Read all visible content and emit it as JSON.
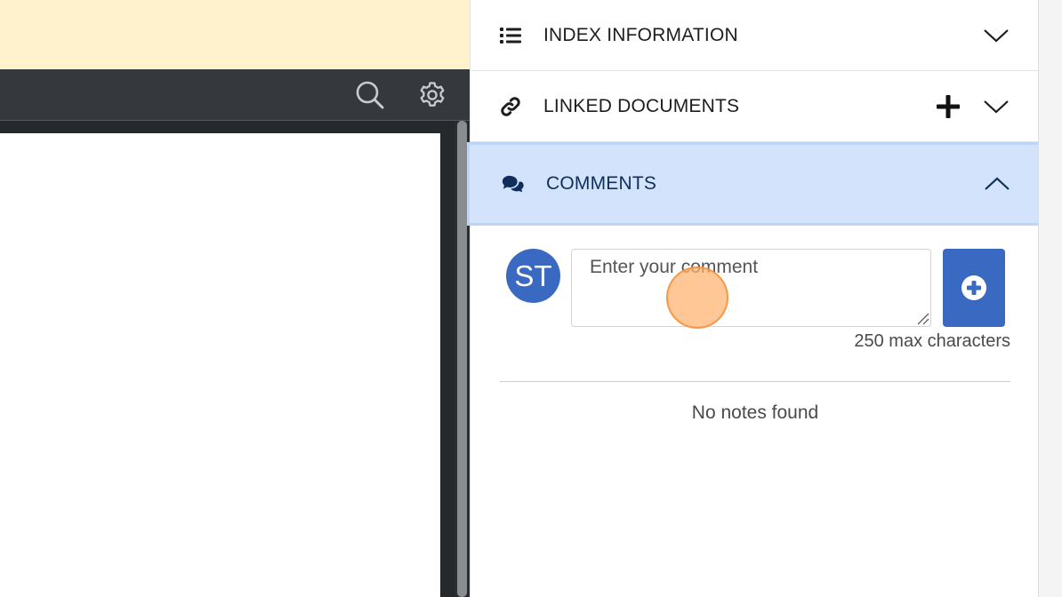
{
  "viewer": {
    "toolbar": {
      "search_icon": "search-icon",
      "settings_icon": "gear-icon"
    }
  },
  "panel": {
    "sections": {
      "index": {
        "title": "INDEX INFORMATION",
        "icon": "list-icon",
        "expanded": false
      },
      "linked": {
        "title": "LINKED DOCUMENTS",
        "icon": "link-icon",
        "expanded": false
      },
      "comments": {
        "title": "COMMENTS",
        "icon": "comments-icon",
        "expanded": true
      }
    },
    "comments": {
      "avatar_initials": "ST",
      "input_placeholder": "Enter your comment",
      "input_value": "",
      "max_chars_text": "250 max characters",
      "empty_text": "No notes found"
    }
  },
  "colors": {
    "accent": "#3a69c2",
    "section_highlight": "#d3e3fb",
    "notice_bar": "#fff2cc",
    "viewer_toolbar": "#35393d"
  }
}
